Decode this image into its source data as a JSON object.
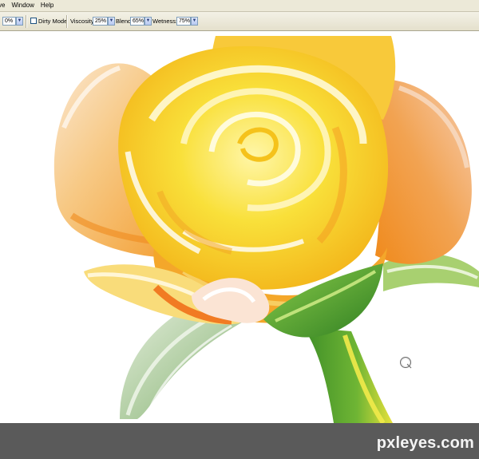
{
  "menu": {
    "items": [
      {
        "label": "ve"
      },
      {
        "label": "Window"
      },
      {
        "label": "Help"
      }
    ]
  },
  "options": {
    "first_value": "0%",
    "dirty_mode_label": "Dirty Mode",
    "dirty_mode_checked": false,
    "viscosity_label": "Viscosity:",
    "viscosity_value": "25%",
    "blend_label": "Blend:",
    "blend_value": "65%",
    "wetness_label": "Wetness:",
    "wetness_value": "75%"
  },
  "icons": {
    "dropdown": "chevron-down-icon",
    "cursor": "brush-cursor-icon"
  },
  "colors": {
    "menu_bg": "#ece9d8",
    "canvas_bg": "#ffffff",
    "bottom_bg": "#5a5a5a",
    "rose_yellow": "#f7d31b",
    "rose_orange": "#f08a1c",
    "leaf_green": "#3f9a2c"
  },
  "watermark": "pxleyes.com"
}
